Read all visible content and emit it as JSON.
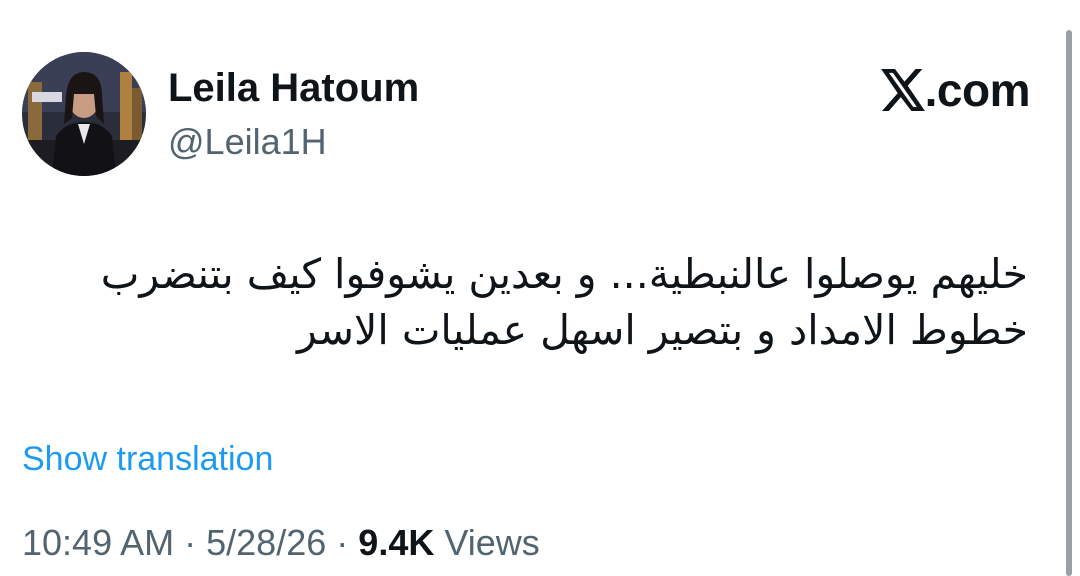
{
  "author": {
    "display_name": "Leila Hatoum",
    "handle": "@Leila1H"
  },
  "brand": {
    "text": ".com",
    "icon": "x-logo-icon"
  },
  "tweet": {
    "lines": [
      "خليهم يوصلوا عالنبطية... و بعدين يشوفوا كيف بتنضرب",
      "خطوط الامداد و بتصير اسهل عمليات الاسر"
    ]
  },
  "show_translation": "Show translation",
  "meta": {
    "time": "10:49 AM",
    "separator": "·",
    "date": "5/28/26",
    "views_count": "9.4K",
    "views_label": "Views"
  },
  "colors": {
    "text": "#0f1419",
    "secondary": "#536471",
    "link": "#1d9bf0"
  }
}
